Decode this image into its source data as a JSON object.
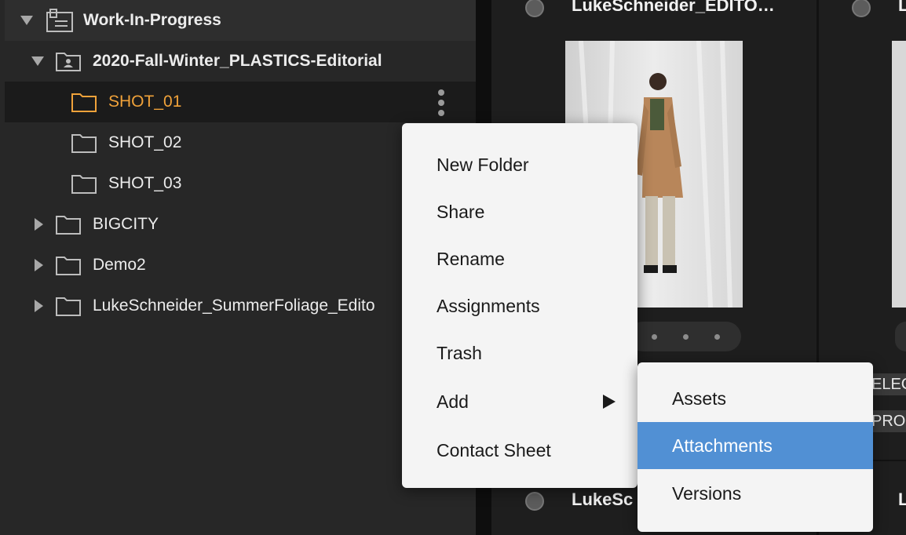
{
  "sidebar": {
    "root_label": "Work-In-Progress",
    "project_label": "2020-Fall-Winter_PLASTICS-Editorial",
    "items": [
      {
        "label": "SHOT_01"
      },
      {
        "label": "SHOT_02"
      },
      {
        "label": "SHOT_03"
      },
      {
        "label": "BIGCITY"
      },
      {
        "label": "Demo2"
      },
      {
        "label": "LukeSchneider_SummerFoliage_Edito"
      }
    ]
  },
  "grid": {
    "card_title_1": "LukeSchneider_EDITO…",
    "card_title_2": "L",
    "card_title_3": "LukeSc",
    "card_title_4": "L",
    "badge_1": "ELEC",
    "badge_2": "PRO"
  },
  "context_menu": {
    "items": [
      {
        "label": "New Folder"
      },
      {
        "label": "Share"
      },
      {
        "label": "Rename"
      },
      {
        "label": "Assignments"
      },
      {
        "label": "Trash"
      },
      {
        "label": "Add"
      },
      {
        "label": "Contact Sheet"
      }
    ]
  },
  "submenu": {
    "items": [
      {
        "label": "Assets"
      },
      {
        "label": "Attachments"
      },
      {
        "label": "Versions"
      }
    ]
  },
  "colors": {
    "accent_folder": "#f0a23a",
    "highlight": "#5190d4"
  }
}
